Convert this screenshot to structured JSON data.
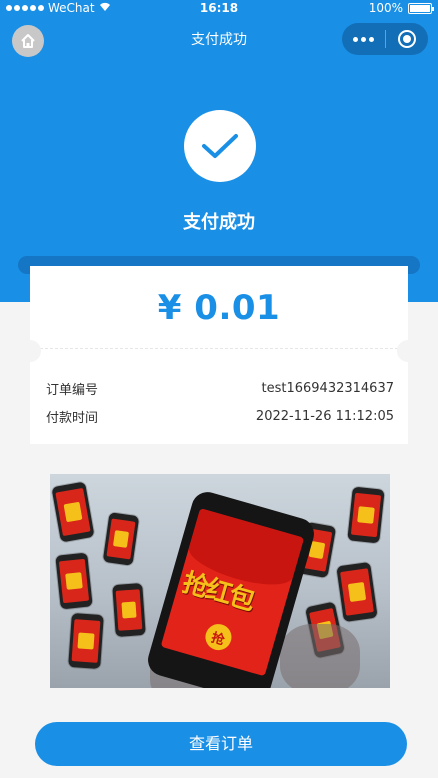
{
  "status_bar": {
    "carrier": "WeChat",
    "time": "16:18",
    "battery": "100%"
  },
  "nav": {
    "title": "支付成功",
    "home_icon": "home-icon",
    "more_icon": "more-dots-icon",
    "close_icon": "close-target-icon"
  },
  "result": {
    "icon": "check-icon",
    "title": "支付成功"
  },
  "payment": {
    "amount": "¥ 0.01",
    "order_no_label": "订单编号",
    "order_no_value": "test1669432314637",
    "pay_time_label": "付款时间",
    "pay_time_value": "2022-11-26 11:12:05"
  },
  "banner": {
    "graphic_text": "抢红包",
    "coin_text": "抢"
  },
  "actions": {
    "view_order_label": "查看订单"
  },
  "colors": {
    "primary": "#1a8fe6",
    "background": "#f4f4f4"
  }
}
